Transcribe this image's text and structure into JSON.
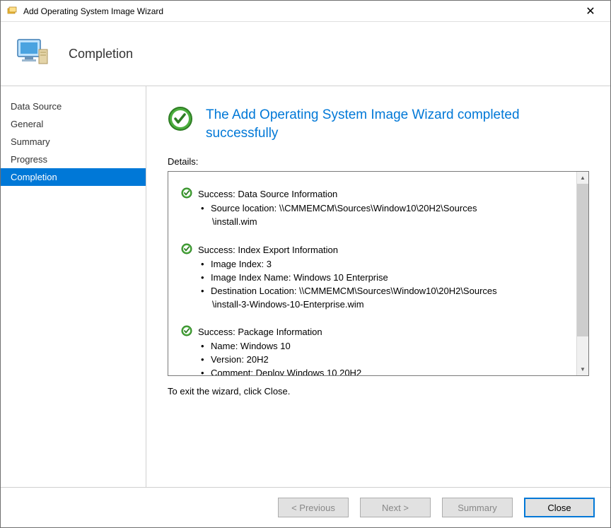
{
  "window": {
    "title": "Add Operating System Image Wizard"
  },
  "banner": {
    "step_title": "Completion"
  },
  "sidebar": {
    "items": [
      {
        "label": "Data Source",
        "selected": false
      },
      {
        "label": "General",
        "selected": false
      },
      {
        "label": "Summary",
        "selected": false
      },
      {
        "label": "Progress",
        "selected": false
      },
      {
        "label": "Completion",
        "selected": true
      }
    ]
  },
  "content": {
    "headline": "The Add Operating System Image Wizard completed successfully",
    "details_label": "Details:",
    "exit_note": "To exit the wizard, click Close.",
    "sections": [
      {
        "status": "Success",
        "title": "Data Source Information",
        "items": [
          {
            "label": "Source location",
            "value": "\\\\CMMEMCM\\Sources\\Window10\\20H2\\Sources\\install.wim",
            "wrap_after": "Sources"
          }
        ]
      },
      {
        "status": "Success",
        "title": "Index Export Information",
        "items": [
          {
            "label": "Image Index",
            "value": "3"
          },
          {
            "label": "Image Index Name",
            "value": "Windows 10 Enterprise"
          },
          {
            "label": "Destination Location",
            "value": "\\\\CMMEMCM\\Sources\\Window10\\20H2\\Sources\\install-3-Windows-10-Enterprise.wim",
            "wrap_after": "Sources"
          }
        ]
      },
      {
        "status": "Success",
        "title": "Package Information",
        "items": [
          {
            "label": "Name",
            "value": "Windows 10"
          },
          {
            "label": "Version",
            "value": "20H2"
          },
          {
            "label": "Comment",
            "value": "Deploy Windows 10 20H2"
          }
        ]
      }
    ]
  },
  "footer": {
    "previous": "< Previous",
    "next": "Next >",
    "summary": "Summary",
    "close": "Close"
  }
}
